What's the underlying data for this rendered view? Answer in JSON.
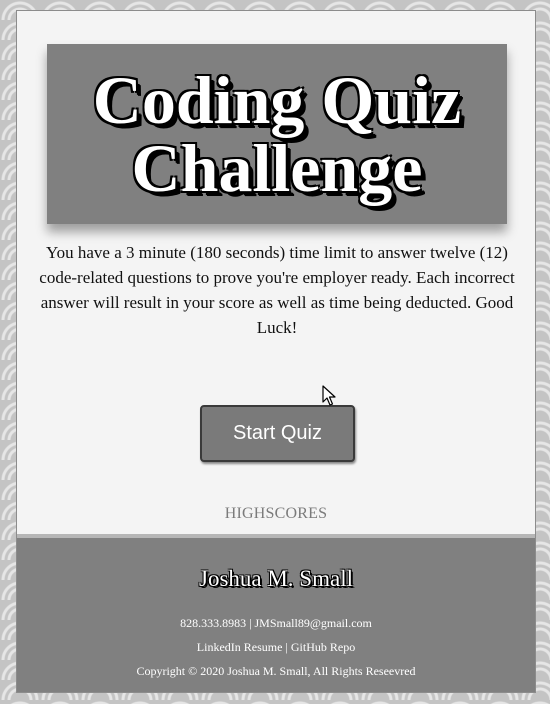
{
  "header": {
    "title_line1": "Coding Quiz",
    "title_line2": "Challenge"
  },
  "main": {
    "instructions": "You have a 3 minute (180 seconds) time limit to answer twelve (12) code-related questions to prove you're employer ready. Each incorrect answer will result in your score as well as time being deducted. Good Luck!",
    "start_button_label": "Start Quiz",
    "highscores_label": "HIGHSCORES"
  },
  "footer": {
    "name": "Joshua M. Small",
    "phone": "828.333.8983",
    "separator": "|",
    "email": "JMSmall89@gmail.com",
    "linkedin_label": "LinkedIn Resume",
    "github_label": "GitHub Repo",
    "copyright": "Copyright © 2020 Joshua M. Small, All Rights Reseevred"
  },
  "colors": {
    "banner": "#808080",
    "panel": "#f4f4f4",
    "button": "#7a7a7a",
    "footer": "#808080"
  },
  "icons": {
    "cursor": "mouse-pointer-icon"
  }
}
